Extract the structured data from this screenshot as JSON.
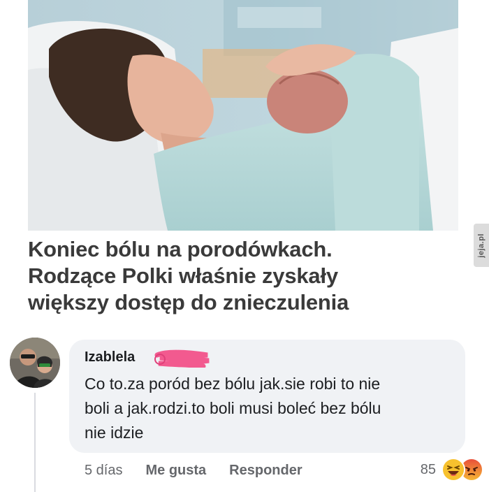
{
  "article": {
    "headline_lines": [
      "Koniec bólu na porodówkach.",
      "Rodzące Polki właśnie zyskały",
      "większy dostęp do znieczulenia"
    ]
  },
  "watermark": {
    "text": "jeja.pl"
  },
  "comment": {
    "author": "Izablela",
    "text_lines": [
      "Co to.za poród bez bólu jak.sie robi to nie",
      "boli a jak.rodzi.to boli musi boleć bez bólu",
      "nie idzie"
    ],
    "time": "5 días",
    "like_label": "Me gusta",
    "reply_label": "Responder",
    "reaction_count": "85",
    "reaction_icons": [
      "laugh-reaction-icon",
      "angry-reaction-icon"
    ]
  },
  "colors": {
    "bubble": "#f0f2f5",
    "redaction": "#f25a8f",
    "meta_text": "#65676b"
  }
}
